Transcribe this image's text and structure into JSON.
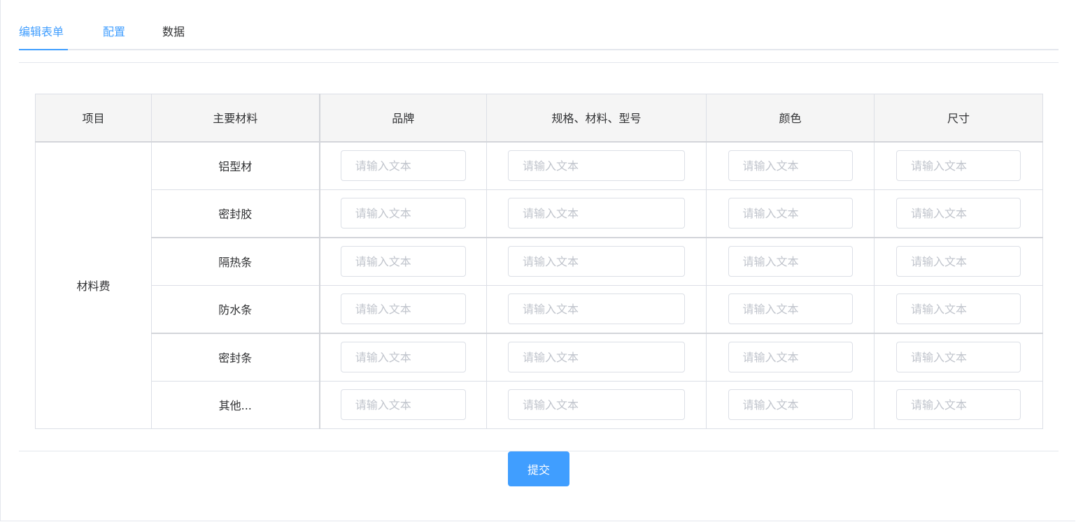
{
  "tabs": [
    {
      "label": "编辑表单"
    },
    {
      "label": "配置"
    },
    {
      "label": "数据"
    }
  ],
  "table": {
    "headers": [
      "项目",
      "主要材料",
      "品牌",
      "规格、材料、型号",
      "颜色",
      "尺寸"
    ],
    "group_label": "材料费",
    "rows": [
      {
        "material": "铝型材"
      },
      {
        "material": "密封胶"
      },
      {
        "material": "隔热条"
      },
      {
        "material": "防水条"
      },
      {
        "material": "密封条"
      },
      {
        "material": "其他..."
      }
    ],
    "input_placeholder": "请输入文本"
  },
  "submit_label": "提交",
  "colors": {
    "accent": "#409eff",
    "header_bg": "#f5f5f5",
    "border": "#dcdfe6",
    "placeholder": "#c0c4cc"
  }
}
